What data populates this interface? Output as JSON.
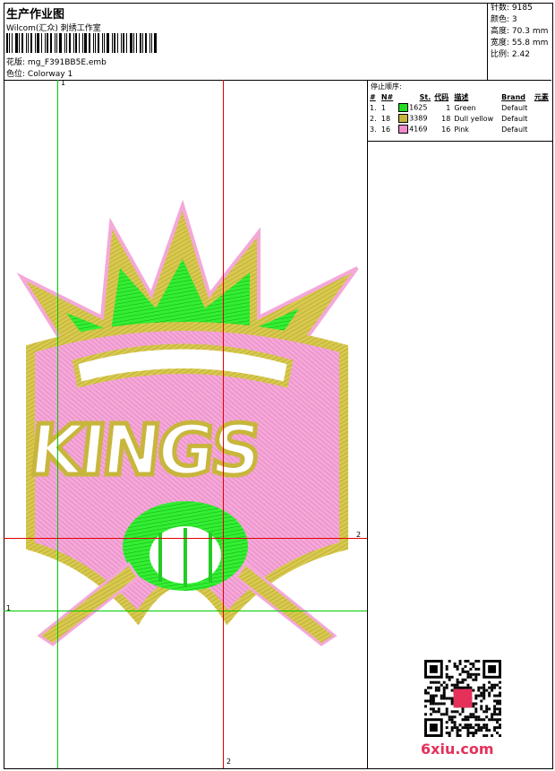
{
  "header": {
    "title": "生产作业图",
    "studio": "Wilcom(汇众) 刺绣工作室",
    "design_label": "花版:",
    "design_value": "mg_F391BB5E.emb",
    "color_label": "色位:",
    "color_value": "Colorway 1"
  },
  "stats": [
    {
      "label": "针数:",
      "value": "9185"
    },
    {
      "label": "颜色:",
      "value": "3"
    },
    {
      "label": "高度:",
      "value": "70.3 mm"
    },
    {
      "label": "宽度:",
      "value": "55.8 mm"
    },
    {
      "label": "比例:",
      "value": "2.42"
    }
  ],
  "stop_sequence": {
    "title": "停止顺序:",
    "headers": [
      "#",
      "N#",
      "St.",
      "代码",
      "描述",
      "Brand",
      "元素"
    ],
    "rows": [
      {
        "idx": "1.",
        "n": "1",
        "color": "#22dd22",
        "st": "1625",
        "code": "1",
        "desc": "Green",
        "brand": "Default"
      },
      {
        "idx": "2.",
        "n": "18",
        "color": "#c8b63c",
        "st": "3389",
        "code": "18",
        "desc": "Dull yellow",
        "brand": "Default"
      },
      {
        "idx": "3.",
        "n": "16",
        "color": "#f08ccc",
        "st": "4169",
        "code": "16",
        "desc": "Pink",
        "brand": "Default"
      }
    ]
  },
  "guides": {
    "green_label_top": "1",
    "green_label_left": "1",
    "red_label_right": "2",
    "red_label_bottom": "2"
  },
  "watermark": "6xiu.com"
}
